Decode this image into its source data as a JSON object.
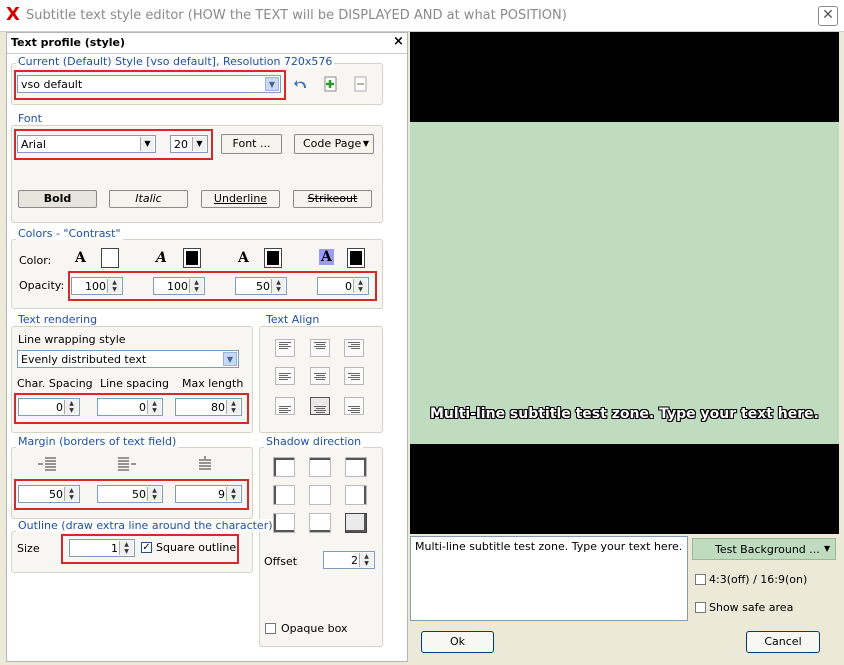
{
  "window": {
    "title": "Subtitle text style editor  (HOW the TEXT will be DISPLAYED AND at what POSITION)",
    "close_glyph": "✕",
    "logo_glyph": "X"
  },
  "panel": {
    "title": "Text profile (style)",
    "close_glyph": "×"
  },
  "current_style": {
    "label": "Current (Default) Style [vso default], Resolution 720x576",
    "value": "vso default"
  },
  "font": {
    "label": "Font",
    "family": "Arial",
    "size": "20",
    "font_button": "Font ...",
    "code_page_button": "Code Page",
    "bold": "Bold",
    "italic": "Italic",
    "underline": "Underline",
    "strikeout": "Strikeout"
  },
  "colors": {
    "label": "Colors - \"Contrast\"",
    "color_label": "Color:",
    "opacity_label": "Opacity:",
    "opacity_values": [
      "100",
      "100",
      "50",
      "0"
    ],
    "swatch_colors": [
      "#ffffff",
      "#000000",
      "#000000",
      "#000000"
    ],
    "glyph": "A"
  },
  "text_rendering": {
    "label": "Text rendering",
    "line_wrapping_label": "Line wrapping style",
    "line_wrapping_value": "Evenly distributed text",
    "char_spacing_label": "Char. Spacing",
    "line_spacing_label": "Line spacing",
    "max_length_label": "Max length",
    "char_spacing": "0",
    "line_spacing": "0",
    "max_length": "80"
  },
  "text_align": {
    "label": "Text Align"
  },
  "margin": {
    "label": "Margin  (borders of text field)",
    "values": [
      "50",
      "50",
      "9"
    ]
  },
  "shadow": {
    "label": "Shadow direction",
    "offset_label": "Offset",
    "offset": "2",
    "opaque_box_label": "Opaque box"
  },
  "outline": {
    "label": "Outline  (draw extra line around the character)",
    "size_label": "Size",
    "size": "1",
    "square_outline_label": "Square outline",
    "square_outline_checked": true
  },
  "preview": {
    "subtitle_text": "Multi-line subtitle test zone. Type your text here.",
    "input_text": "Multi-line subtitle test zone. Type your text here.",
    "background_button": "Test Background ...",
    "aspect_label": "4:3(off) / 16:9(on)",
    "safe_area_label": "Show safe area"
  },
  "buttons": {
    "ok": "Ok",
    "cancel": "Cancel"
  }
}
